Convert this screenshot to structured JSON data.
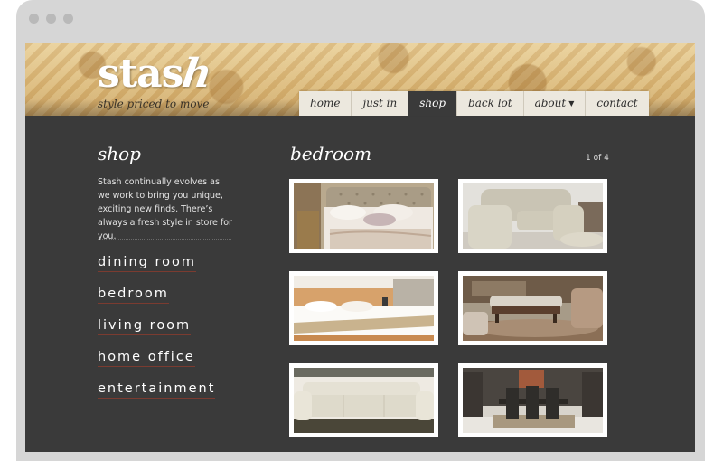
{
  "header": {
    "logo_text": "stas",
    "logo_h": "h",
    "tagline": "style priced to move"
  },
  "nav": {
    "items": [
      {
        "label": "home"
      },
      {
        "label": "just in"
      },
      {
        "label": "shop",
        "active": true
      },
      {
        "label": "back lot"
      },
      {
        "label": "about",
        "has_dropdown": true
      },
      {
        "label": "contact"
      }
    ]
  },
  "sidebar": {
    "title": "shop",
    "description": "Stash continually evolves as we work to bring you unique, exciting new finds. There’s always a fresh style in store for you.",
    "items": [
      {
        "label": "dining room"
      },
      {
        "label": "bedroom"
      },
      {
        "label": "living room"
      },
      {
        "label": "home office"
      },
      {
        "label": "entertainment"
      }
    ]
  },
  "main": {
    "title": "bedroom",
    "pager": "1 of 4",
    "thumbnails": [
      {
        "alt": "tufted upholstered bed with neutral linens"
      },
      {
        "alt": "slipcovered armchair with ottoman"
      },
      {
        "alt": "platform bed with wood headboard"
      },
      {
        "alt": "living room with tufted ottoman and sofa"
      },
      {
        "alt": "cream leather sofa"
      },
      {
        "alt": "dining set with dark chairs"
      }
    ]
  },
  "colors": {
    "page_bg": "#3a3a3a",
    "accent_underline": "#7b3b30",
    "nav_bg": "#ece8de"
  }
}
